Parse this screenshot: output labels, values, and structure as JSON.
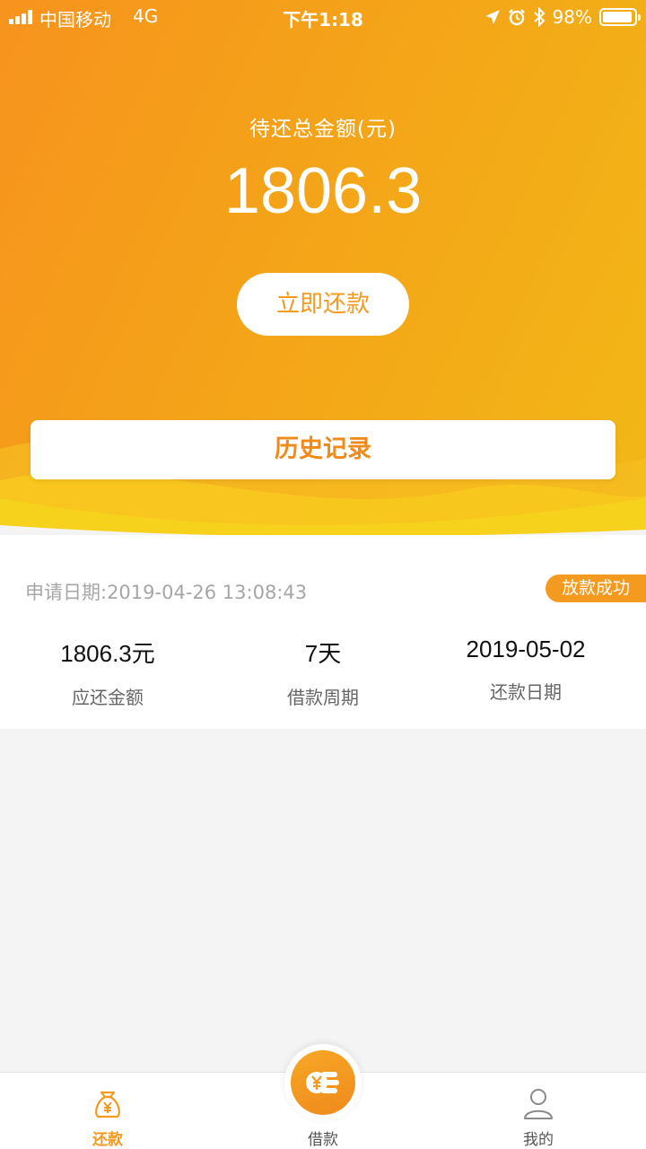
{
  "status_bar": {
    "carrier": "中国移动",
    "network": "4G",
    "time": "下午1:18",
    "battery": "98%",
    "icons": [
      "signal-icon",
      "location-icon",
      "alarm-icon",
      "bluetooth-icon",
      "battery-icon"
    ]
  },
  "summary": {
    "label": "待还总金额(元)",
    "amount": "1806.3",
    "repay_button": "立即还款",
    "history_button": "历史记录"
  },
  "loan": {
    "apply_date": "申请日期:2019-04-26 13:08:43",
    "status": "放款成功",
    "stats": [
      {
        "value": "1806.3元",
        "label": "应还金额"
      },
      {
        "value": "7天",
        "label": "借款周期"
      },
      {
        "value": "2019-05-02",
        "label": "还款日期"
      }
    ]
  },
  "tabbar": {
    "tabs": [
      {
        "label": "还款",
        "icon": "money-bag-icon",
        "active": true
      },
      {
        "label": "借款",
        "icon": "yen-coins-icon",
        "active": false
      },
      {
        "label": "我的",
        "icon": "user-icon",
        "active": false
      }
    ]
  },
  "colors": {
    "accent": "#f39a1f",
    "gradient_start": "#f7931e",
    "gradient_end": "#f2b816",
    "wave": "#f7d21c"
  }
}
